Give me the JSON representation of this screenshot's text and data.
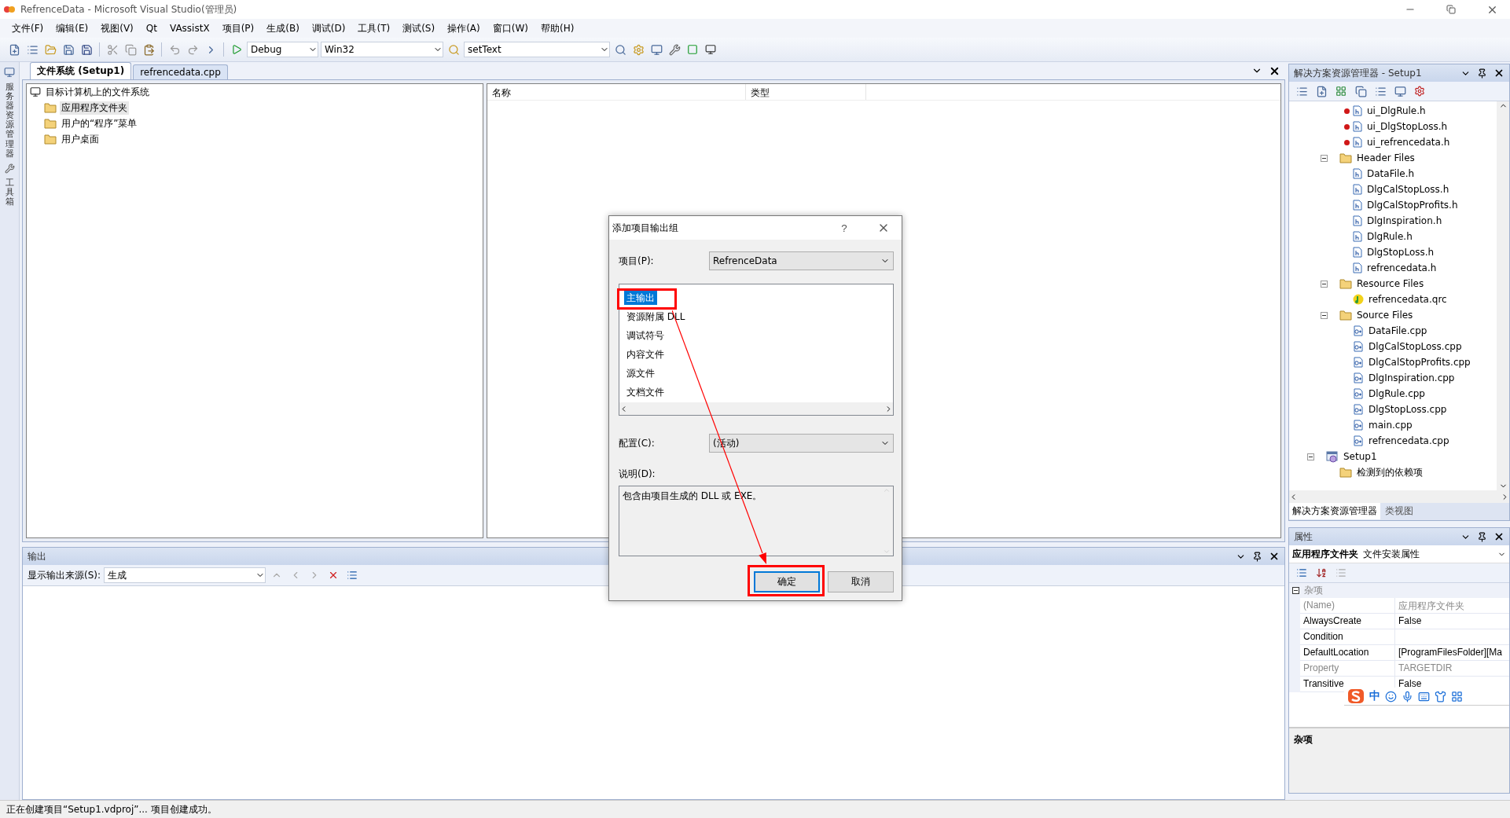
{
  "window": {
    "title": "RefrenceData - Microsoft Visual Studio(管理员)"
  },
  "menu": [
    "文件(F)",
    "编辑(E)",
    "视图(V)",
    "Qt",
    "VAssistX",
    "项目(P)",
    "生成(B)",
    "调试(D)",
    "工具(T)",
    "测试(S)",
    "操作(A)",
    "窗口(W)",
    "帮助(H)"
  ],
  "toolbar": {
    "configuration": "Debug",
    "platform": "Win32",
    "find": "setText"
  },
  "side_strip": [
    "服务器资源管理器",
    "工具箱"
  ],
  "document_tabs": [
    {
      "label": "文件系统 (Setup1)",
      "selected": true
    },
    {
      "label": "refrencedata.cpp",
      "selected": false
    }
  ],
  "file_system": {
    "root": "目标计算机上的文件系统",
    "folders": [
      {
        "label": "应用程序文件夹",
        "selected": true
      },
      {
        "label": "用户的“程序”菜单",
        "selected": false
      },
      {
        "label": "用户桌面",
        "selected": false
      }
    ]
  },
  "file_list": {
    "columns": [
      "名称",
      "类型"
    ]
  },
  "output": {
    "title": "输出",
    "source_label": "显示输出来源(S):",
    "source": "生成"
  },
  "status_bar": "正在创建项目“Setup1.vdproj”... 项目创建成功。",
  "solution_explorer": {
    "title": "解决方案资源管理器 - Setup1",
    "scrolled_items": [
      {
        "label": "ui_DlgRule.h",
        "kind": "header",
        "excluded": true
      },
      {
        "label": "ui_DlgStopLoss.h",
        "kind": "header",
        "excluded": true
      },
      {
        "label": "ui_refrencedata.h",
        "kind": "header",
        "excluded": true
      }
    ],
    "folders": [
      {
        "label": "Header Files",
        "kind": "folder",
        "expanded": true,
        "children": [
          {
            "label": "DataFile.h",
            "kind": "header"
          },
          {
            "label": "DlgCalStopLoss.h",
            "kind": "header"
          },
          {
            "label": "DlgCalStopProfits.h",
            "kind": "header"
          },
          {
            "label": "DlgInspiration.h",
            "kind": "header"
          },
          {
            "label": "DlgRule.h",
            "kind": "header"
          },
          {
            "label": "DlgStopLoss.h",
            "kind": "header"
          },
          {
            "label": "refrencedata.h",
            "kind": "header"
          }
        ]
      },
      {
        "label": "Resource Files",
        "kind": "folder",
        "expanded": true,
        "children": [
          {
            "label": "refrencedata.qrc",
            "kind": "resource"
          }
        ]
      },
      {
        "label": "Source Files",
        "kind": "folder",
        "expanded": true,
        "children": [
          {
            "label": "DataFile.cpp",
            "kind": "source"
          },
          {
            "label": "DlgCalStopLoss.cpp",
            "kind": "source"
          },
          {
            "label": "DlgCalStopProfits.cpp",
            "kind": "source"
          },
          {
            "label": "DlgInspiration.cpp",
            "kind": "source"
          },
          {
            "label": "DlgRule.cpp",
            "kind": "source"
          },
          {
            "label": "DlgStopLoss.cpp",
            "kind": "source"
          },
          {
            "label": "main.cpp",
            "kind": "source"
          },
          {
            "label": "refrencedata.cpp",
            "kind": "source"
          }
        ]
      }
    ],
    "projects": [
      {
        "label": "Setup1",
        "kind": "setup",
        "expanded": true,
        "children": [
          {
            "label": "检测到的依赖项",
            "kind": "folder"
          }
        ]
      }
    ],
    "tabs": [
      {
        "label": "解决方案资源管理器",
        "selected": true
      },
      {
        "label": "类视图",
        "selected": false
      }
    ]
  },
  "properties": {
    "title": "属性",
    "object": "应用程序文件夹",
    "object_type": "文件安装属性",
    "category": "杂项",
    "rows": [
      {
        "name": "(Name)",
        "value": "应用程序文件夹",
        "readonly": true
      },
      {
        "name": "AlwaysCreate",
        "value": "False",
        "readonly": false
      },
      {
        "name": "Condition",
        "readonly": false
      },
      {
        "name": "DefaultLocation",
        "value": "[ProgramFilesFolder][Ma",
        "readonly": false
      },
      {
        "name": "Property",
        "value": "TARGETDIR",
        "readonly": true
      },
      {
        "name": "Transitive",
        "value": "False",
        "readonly": false
      }
    ],
    "description_title": "杂项"
  },
  "ime_bar": {
    "mode": "中"
  },
  "dialog": {
    "title": "添加项目输出组",
    "help": "?",
    "project_label": "项目(P):",
    "project": "RefrenceData",
    "outputs": [
      {
        "label": "主输出",
        "selected": true
      },
      {
        "label": "资源附属 DLL",
        "selected": false
      },
      {
        "label": "调试符号",
        "selected": false
      },
      {
        "label": "内容文件",
        "selected": false
      },
      {
        "label": "源文件",
        "selected": false
      },
      {
        "label": "文档文件",
        "selected": false
      }
    ],
    "config_label": "配置(C):",
    "config": "(活动)",
    "description_label": "说明(D):",
    "description": "包含由项目生成的 DLL 或 EXE。",
    "buttons": [
      {
        "label": "确定",
        "default": true
      },
      {
        "label": "取消",
        "default": false
      }
    ]
  }
}
